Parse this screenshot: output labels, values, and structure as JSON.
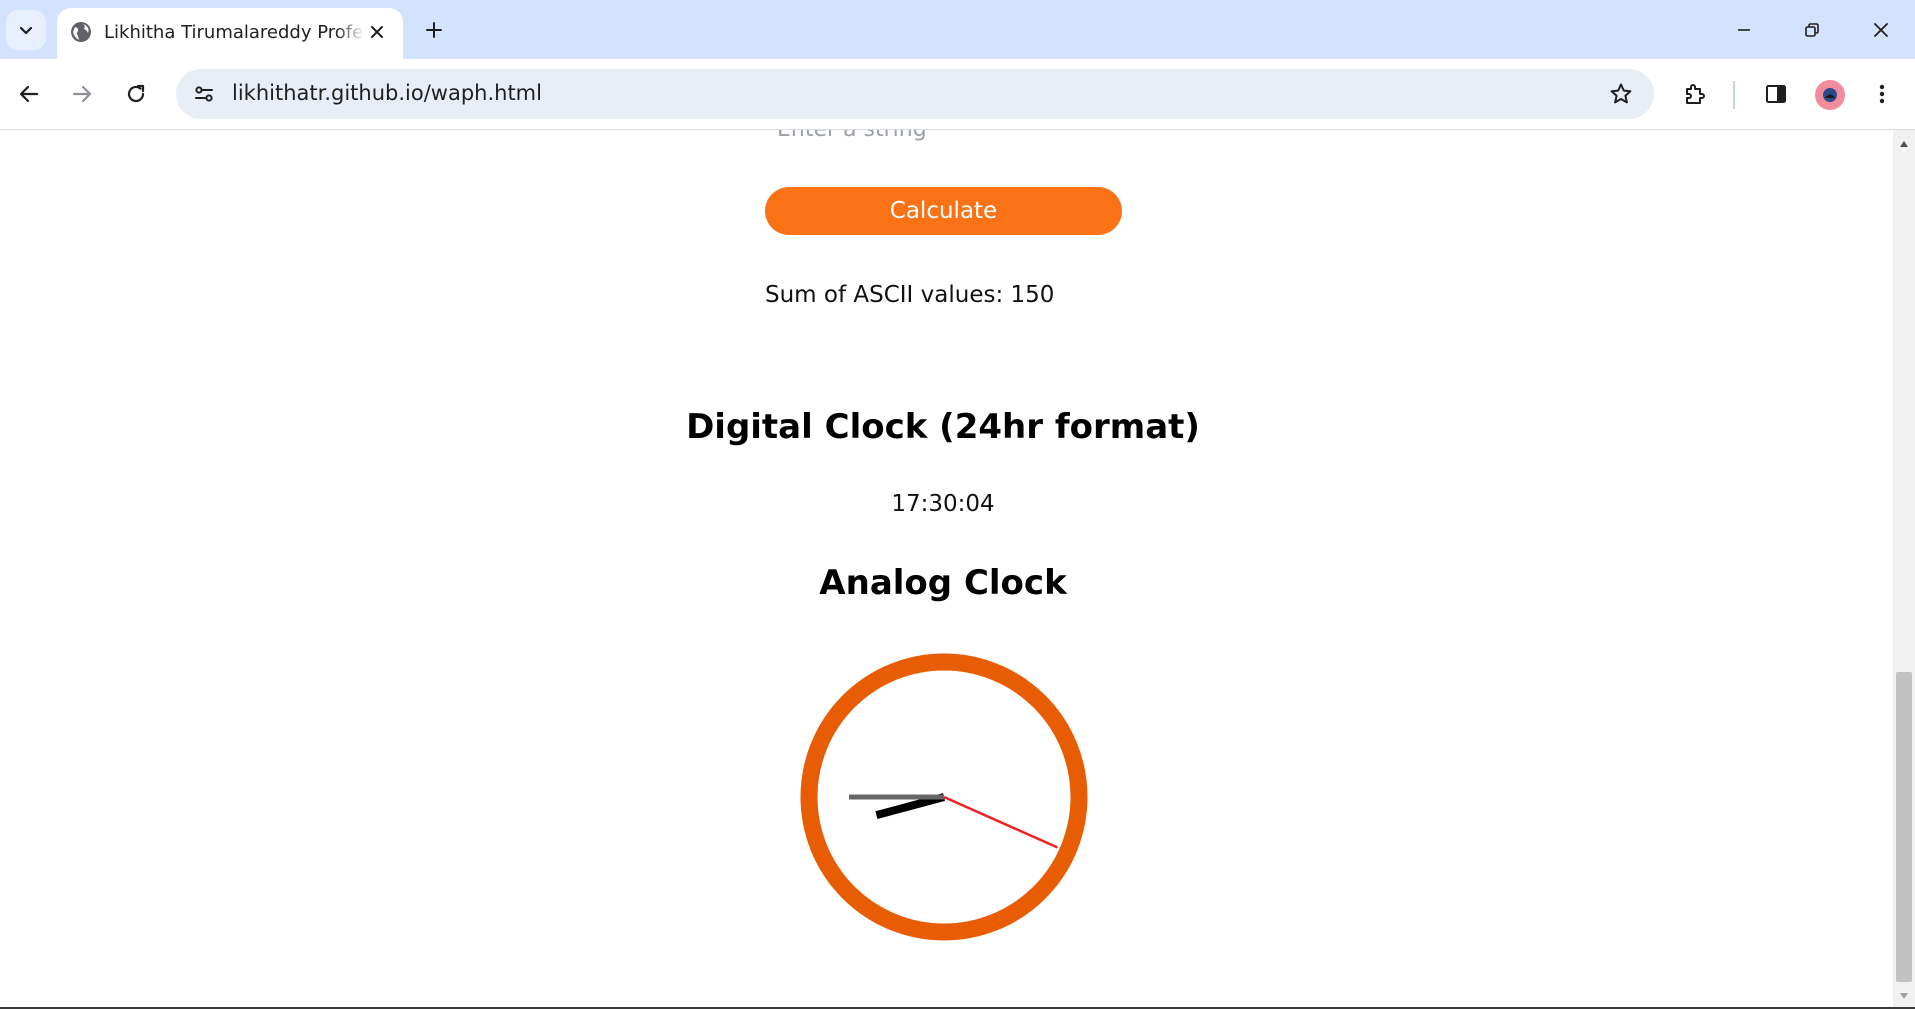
{
  "browser": {
    "tab": {
      "title": "Likhitha Tirumalareddy Professional Profile"
    },
    "address": {
      "url": "likhithatr.github.io/waph.html"
    }
  },
  "page": {
    "input_placeholder": "Enter a string",
    "calculate_label": "Calculate",
    "ascii_result": "Sum of ASCII values: 150",
    "digital_clock_heading": "Digital Clock (24hr format)",
    "digital_time": "17:30:04",
    "analog_clock_heading": "Analog Clock",
    "clock_time": {
      "hours": 17,
      "minutes": 30,
      "seconds": 4
    }
  },
  "colors": {
    "accent": "#f97316",
    "clock_ring": "#e85d04",
    "second_hand": "#ee2222",
    "tab_strip": "#d3e3fd",
    "omnibox": "#e9eef6"
  }
}
